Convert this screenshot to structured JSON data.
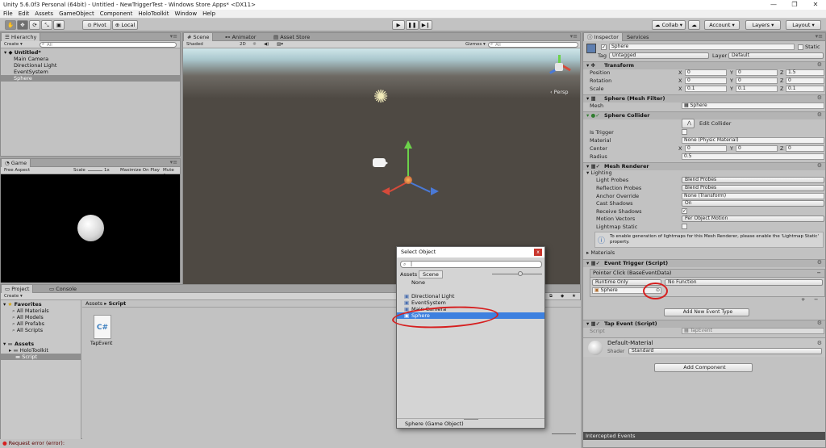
{
  "window": {
    "title": "Unity 5.6.0f3 Personal (64bit) - Untitled - NewTriggerTest - Windows Store Apps* <DX11>",
    "controls": [
      "—",
      "❐",
      "✕"
    ]
  },
  "menu": [
    "File",
    "Edit",
    "Assets",
    "GameObject",
    "Component",
    "HoloToolkit",
    "Window",
    "Help"
  ],
  "toolbar": {
    "pivot": "Pivot",
    "local": "Local",
    "collab": "Collab ▾",
    "account": "Account",
    "layers": "Layers",
    "layout": "Layout"
  },
  "hierarchy": {
    "tab": "Hierarchy",
    "create": "Create ▾",
    "search_placeholder": "All",
    "scene": "Untitled*",
    "items": [
      "Main Camera",
      "Directional Light",
      "EventSystem",
      "Sphere"
    ]
  },
  "scene_view": {
    "tabs": [
      "Scene",
      "Animator",
      "Asset Store"
    ],
    "shading": "Shaded",
    "mode_2d": "2D",
    "gizmos": "Gizmos ▾",
    "search_placeholder": "All",
    "persp": "Persp"
  },
  "game_view": {
    "tab": "Game",
    "aspect": "Free Aspect",
    "scale_label": "Scale",
    "scale_value": "1x",
    "maximize": "Maximize On Play",
    "mute": "Mute Au"
  },
  "project": {
    "tabs": [
      "Project",
      "Console"
    ],
    "create": "Create ▾",
    "favorites": "Favorites",
    "favorite_items": [
      "All Materials",
      "All Models",
      "All Prefabs",
      "All Scripts"
    ],
    "assets": "Assets",
    "asset_folders": [
      "HoloToolkit",
      "Script"
    ],
    "breadcrumb": [
      "Assets",
      "Script"
    ],
    "file_name": "TapEvent",
    "file_icon_text": "C#"
  },
  "status": {
    "message": "Request error (error):"
  },
  "inspector": {
    "tabs": [
      "Inspector",
      "Services"
    ],
    "object_name": "Sphere",
    "static_label": "Static",
    "tag_label": "Tag",
    "tag_value": "Untagged",
    "layer_label": "Layer",
    "layer_value": "Default",
    "transform": {
      "title": "Transform",
      "position": {
        "label": "Position",
        "x": "0",
        "y": "0",
        "z": "1.5"
      },
      "rotation": {
        "label": "Rotation",
        "x": "0",
        "y": "0",
        "z": "0"
      },
      "scale": {
        "label": "Scale",
        "x": "0.1",
        "y": "0.1",
        "z": "0.1"
      }
    },
    "mesh_filter": {
      "title": "Sphere (Mesh Filter)",
      "mesh_label": "Mesh",
      "mesh_value": "Sphere"
    },
    "sphere_collider": {
      "title": "Sphere Collider",
      "edit_collider": "Edit Collider",
      "is_trigger": "Is Trigger",
      "material_label": "Material",
      "material_value": "None (Physic Material)",
      "center_label": "Center",
      "center": {
        "x": "0",
        "y": "0",
        "z": "0"
      },
      "radius_label": "Radius",
      "radius_value": "0.5"
    },
    "mesh_renderer": {
      "title": "Mesh Renderer",
      "lighting": "Lighting",
      "light_probes_label": "Light Probes",
      "light_probes_value": "Blend Probes",
      "reflection_probes_label": "Reflection Probes",
      "reflection_probes_value": "Blend Probes",
      "anchor_label": "Anchor Override",
      "anchor_value": "None (Transform)",
      "cast_shadows_label": "Cast Shadows",
      "cast_shadows_value": "On",
      "receive_shadows_label": "Receive Shadows",
      "motion_vectors_label": "Motion Vectors",
      "motion_vectors_value": "Per Object Motion",
      "lightmap_static_label": "Lightmap Static",
      "info": "To enable generation of lightmaps for this Mesh Renderer, please enable the 'Lightmap Static' property.",
      "materials": "Materials"
    },
    "event_trigger": {
      "title": "Event Trigger (Script)",
      "event_type": "Pointer Click (BaseEventData)",
      "runtime": "Runtime Only",
      "function": "No Function",
      "target": "Sphere",
      "plus": "+",
      "minus": "−",
      "add_event": "Add New Event Type"
    },
    "tap_event": {
      "title": "Tap Event (Script)",
      "script_label": "Script",
      "script_value": "TapEvent"
    },
    "material": {
      "name": "Default-Material",
      "shader_label": "Shader",
      "shader_value": "Standard"
    },
    "add_component": "Add Component",
    "intercepted": "Intercepted Events"
  },
  "select_object": {
    "title": "Select Object",
    "close": "x",
    "tabs": [
      "Assets",
      "Scene"
    ],
    "none": "None",
    "items": [
      "Directional Light",
      "EventSystem",
      "Main Camera",
      "Sphere"
    ],
    "selected_index": 3,
    "footer": "Sphere (Game Object)"
  },
  "colors": {
    "selection_blue": "#3d80df",
    "annotation_red": "#d61f1f",
    "scene_ground": "#4e4943",
    "game_bg": "#000000"
  }
}
